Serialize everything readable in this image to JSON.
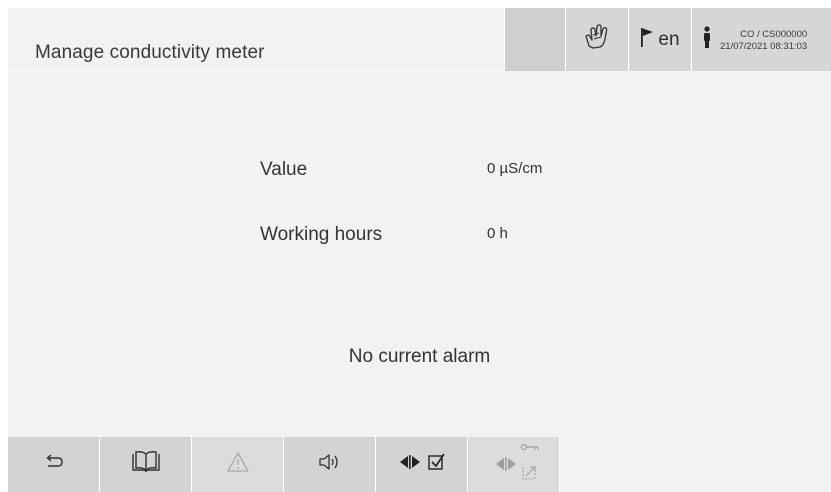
{
  "header": {
    "title": "Manage conductivity meter",
    "language": "en",
    "user_code": "CO / CS000000",
    "datetime": "21/07/2021 08:31:03",
    "icons": {
      "operator": "hand-icon",
      "language": "flag-icon",
      "user": "user-icon"
    }
  },
  "main": {
    "fields": [
      {
        "label": "Value",
        "value": "0 µS/cm"
      },
      {
        "label": "Working hours",
        "value": "0 h"
      }
    ],
    "alarm_text": "No current alarm"
  },
  "footer": {
    "buttons": [
      {
        "icon": "back-arrow-icon",
        "enabled": true
      },
      {
        "icon": "book-icon",
        "enabled": true
      },
      {
        "icon": "warning-icon",
        "enabled": false
      },
      {
        "icon": "speaker-icon",
        "enabled": true
      },
      {
        "icon": "valve-check-icon",
        "enabled": true
      },
      {
        "icon": "valve-key-icon",
        "enabled": false
      }
    ]
  },
  "colors": {
    "background": "#f2f2f2",
    "button": "#d3d3d3",
    "text": "#2e2e2e",
    "disabled_icon": "#a9a9a9"
  }
}
